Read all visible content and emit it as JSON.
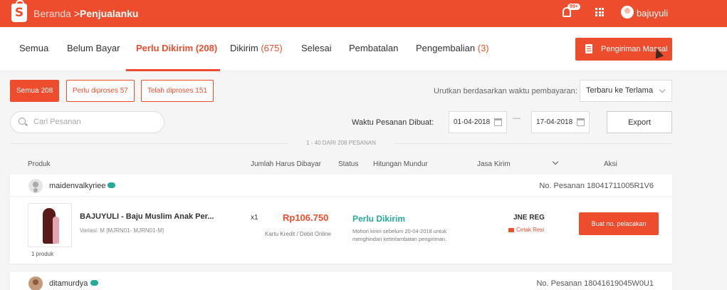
{
  "header": {
    "logo_letter": "S",
    "breadcrumb_home": "Beranda",
    "breadcrumb_sep": " >",
    "breadcrumb_current": "Penjualanku",
    "notif_badge": "99+",
    "username": "bajuyuli"
  },
  "tabs": [
    {
      "label": "Semua",
      "count": ""
    },
    {
      "label": "Belum Bayar",
      "count": ""
    },
    {
      "label": "Perlu Dikirim",
      "count": "(208)"
    },
    {
      "label": "Dikirim",
      "count": "(675)"
    },
    {
      "label": "Selesai",
      "count": ""
    },
    {
      "label": "Pembatalan",
      "count": ""
    },
    {
      "label": "Pengembalian",
      "count": "(3)"
    }
  ],
  "mass_ship_label": "Pengiriman Massal",
  "filters": [
    {
      "label": "Semua 208"
    },
    {
      "label": "Perlu diproses 57"
    },
    {
      "label": "Telah diproses 151"
    }
  ],
  "sort": {
    "label": "Urutkan berdasarkan waktu pembayaran:",
    "value": "Terbaru ke Terlama"
  },
  "search": {
    "placeholder": "Cari Pesanan"
  },
  "date_filter": {
    "label": "Waktu Pesanan Dibuat:",
    "from": "01-04-2018",
    "separator": "—",
    "to": "17-04-2018"
  },
  "export_label": "Export",
  "range_text": "1 - 40 DARI 208 PESANAN",
  "columns": {
    "product": "Produk",
    "amount": "Jumlah Harus Dibayar",
    "status": "Status",
    "countdown": "Hitungan Mundur",
    "courier": "Jasa Kirim",
    "action": "Aksi"
  },
  "orders": [
    {
      "buyer": "maidenvalkyriee",
      "order_no": "No. Pesanan 18041711005R1V6",
      "product_name": "BAJUYULI - Baju Muslim Anak Per...",
      "variant": "Variasi: M [MJRN01- MJRN01-M]",
      "item_count": "1 produk",
      "qty": "x1",
      "price": "Rp106.750",
      "payment": "Kartu Kredit / Debit Online",
      "status": "Perlu Dikirim",
      "note": "Mohon kirim sebelum 20-04-2018 untuk menghindari keterlambatan pengiriman.",
      "courier": "JNE REG",
      "print_label": "Cetak Resi",
      "action_label": "Buat no. pelacakan"
    },
    {
      "buyer": "ditamurdya",
      "order_no": "No. Pesanan 18041619045W0U1"
    }
  ]
}
